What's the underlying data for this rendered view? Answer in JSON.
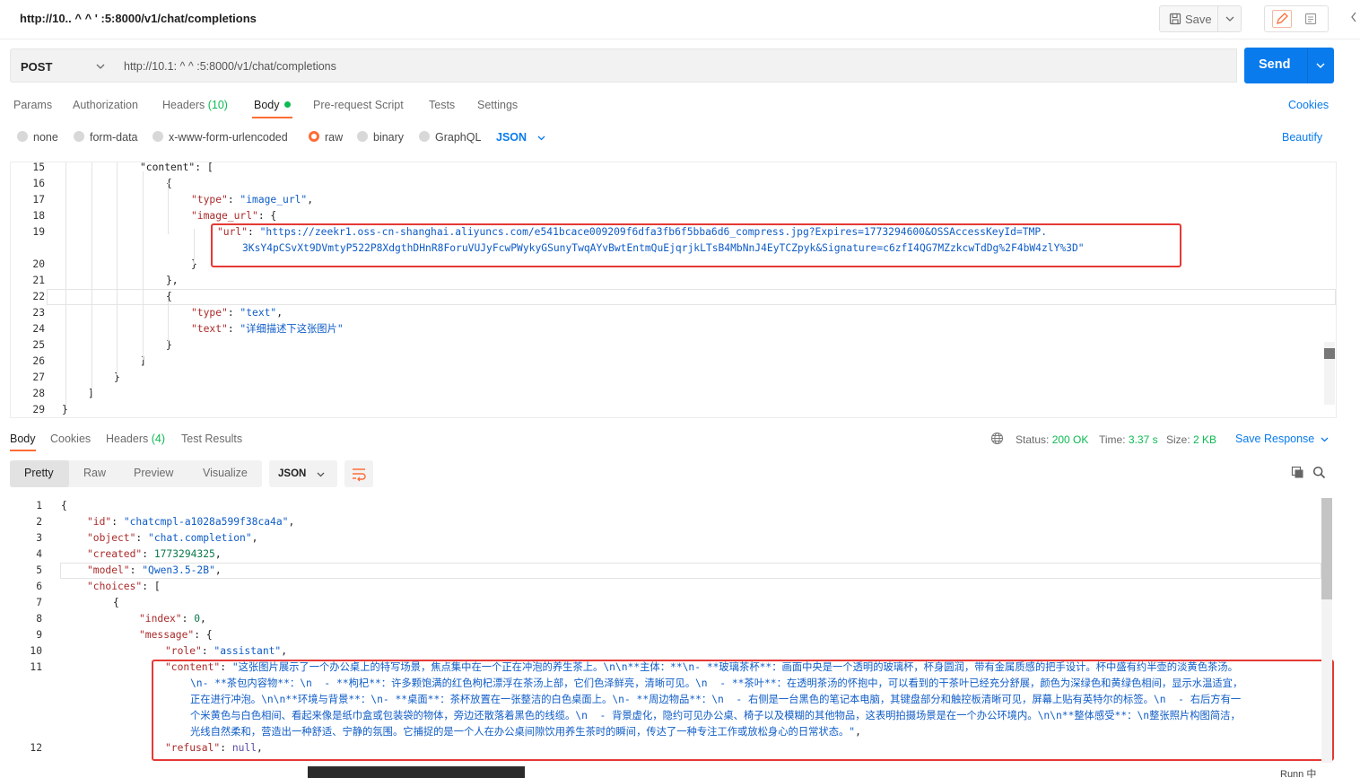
{
  "title_bar": {
    "title": "http://10..  ^ ^ '  :5:8000/v1/chat/completions",
    "save_label": "Save"
  },
  "request": {
    "method": "POST",
    "url": "http://10.1:  ^  ^ :5:8000/v1/chat/completions",
    "send_label": "Send"
  },
  "request_tabs": [
    {
      "label": "Params"
    },
    {
      "label": "Authorization"
    },
    {
      "label": "Headers",
      "count": "(10)"
    },
    {
      "label": "Body"
    },
    {
      "label": "Pre-request Script"
    },
    {
      "label": "Tests"
    },
    {
      "label": "Settings"
    }
  ],
  "cookies_label": "Cookies",
  "body_types": [
    "none",
    "form-data",
    "x-www-form-urlencoded",
    "raw",
    "binary",
    "GraphQL"
  ],
  "body_format": "JSON",
  "beautify_label": "Beautify",
  "request_body_lines": [
    {
      "n": "15",
      "text": "\"content\": ["
    },
    {
      "n": "16",
      "text": "{"
    },
    {
      "n": "17",
      "key": "\"type\"",
      "val": "\"image_url\"",
      "tail": ","
    },
    {
      "n": "18",
      "key": "\"image_url\"",
      "tail": ": {"
    },
    {
      "n": "19",
      "key": "\"url\"",
      "val": "\"https://zeekr1.oss-cn-shanghai.aliyuncs.com/e541bcace009209f6dfa3fb6f5bba6d6_compress.jpg?Expires=1773294600&OSSAccessKeyId=TMP."
    },
    {
      "n": "",
      "val": "3KsY4pCSvXt9DVmtyP522P8XdgthDHnR8ForuVUJyFcwPWykyGSunyTwqAYvBwtEntmQuEjqrjkLTsB4MbNnJ4EyTCZpyk&Signature=c6zfI4QG7MZzkcwTdDg%2F4bW4zlY%3D\""
    },
    {
      "n": "20",
      "text": "}"
    },
    {
      "n": "21",
      "text": "},"
    },
    {
      "n": "22",
      "text": "{"
    },
    {
      "n": "23",
      "key": "\"type\"",
      "val": "\"text\"",
      "tail": ","
    },
    {
      "n": "24",
      "key": "\"text\"",
      "val": "\"详细描述下这张图片\""
    },
    {
      "n": "25",
      "text": "}"
    },
    {
      "n": "26",
      "text": "]"
    },
    {
      "n": "27",
      "text": "}"
    },
    {
      "n": "28",
      "text": "]"
    },
    {
      "n": "29",
      "text": "}"
    }
  ],
  "response_tabs": [
    {
      "label": "Body"
    },
    {
      "label": "Cookies"
    },
    {
      "label": "Headers",
      "count": "(4)"
    },
    {
      "label": "Test Results"
    }
  ],
  "response_meta": {
    "status_label": "Status:",
    "status": "200 OK",
    "time_label": "Time:",
    "time": "3.37 s",
    "size_label": "Size:",
    "size": "2 KB",
    "save_response": "Save Response"
  },
  "view_tabs": [
    "Pretty",
    "Raw",
    "Preview",
    "Visualize"
  ],
  "response_format": "JSON",
  "response_lines": [
    {
      "n": "1",
      "text": "{"
    },
    {
      "n": "2",
      "key": "\"id\"",
      "val": "\"chatcmpl-a1028a599f38ca4a\"",
      "tail": ","
    },
    {
      "n": "3",
      "key": "\"object\"",
      "val": "\"chat.completion\"",
      "tail": ","
    },
    {
      "n": "4",
      "key": "\"created\"",
      "num": "1773294325",
      "tail": ","
    },
    {
      "n": "5",
      "key": "\"model\"",
      "val": "\"Qwen3.5-2B\"",
      "tail": ","
    },
    {
      "n": "6",
      "key": "\"choices\"",
      "tail": ": ["
    },
    {
      "n": "7",
      "text": "{"
    },
    {
      "n": "8",
      "key": "\"index\"",
      "num": "0",
      "tail": ","
    },
    {
      "n": "9",
      "key": "\"message\"",
      "tail": ": {"
    },
    {
      "n": "10",
      "key": "\"role\"",
      "val": "\"assistant\"",
      "tail": ","
    },
    {
      "n": "11",
      "key": "\"content\"",
      "val": "\"这张图片展示了一个办公桌上的特写场景，焦点集中在一个正在冲泡的养生茶上。\\n\\n**主体：**\\n- **玻璃茶杯**：画面中央是一个透明的玻璃杯，杯身圆润，带有金属质感的把手设计。杯中盛有约半壶的淡黄色茶汤。"
    },
    {
      "n": "",
      "val": "\\n- **茶包内容物**：\\n  - **枸杞**：许多颗饱满的红色枸杞漂浮在茶汤上部，它们色泽鲜亮，清晰可见。\\n  - **茶叶**：在透明茶汤的怀抱中，可以看到的干茶叶已经充分舒展，颜色为深绿色和黄绿色相间，显示水温适宜，"
    },
    {
      "n": "",
      "val": "正在进行冲泡。\\n\\n**环境与背景**：\\n- **桌面**：茶杯放置在一张整洁的白色桌面上。\\n- **周边物品**：\\n  - 右侧是一台黑色的笔记本电脑，其键盘部分和触控板清晰可见，屏幕上贴有英特尔的标签。\\n  - 右后方有一"
    },
    {
      "n": "",
      "val": "个米黄色与白色相间、看起来像是纸巾盒或包装袋的物体，旁边还散落着黑色的线缆。\\n  - 背景虚化，隐约可见办公桌、椅子以及模糊的其他物品，这表明拍摄场景是在一个办公环境内。\\n\\n**整体感受**：\\n整张照片构图简洁，"
    },
    {
      "n": "",
      "val": "光线自然柔和，营造出一种舒适、宁静的氛围。它捕捉的是一个人在办公桌间隙饮用养生茶时的瞬间，传达了一种专注工作或放松身心的日常状态。\"",
      "tail": ","
    },
    {
      "n": "12",
      "key": "\"refusal\"",
      "lit": "null",
      "tail": ","
    }
  ],
  "bottom_bar": {
    "runner": "Runn  中"
  },
  "colors": {
    "accent": "#ff6c37",
    "send": "#097bed",
    "status_ok": "#0cbb52",
    "highlight_box": "#e53935"
  }
}
